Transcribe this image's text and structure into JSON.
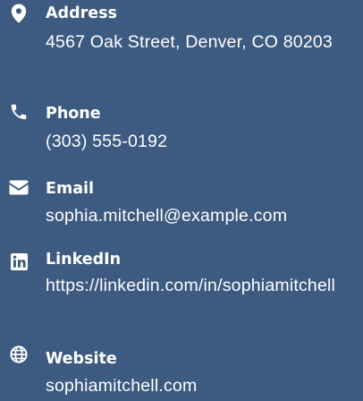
{
  "colors": {
    "background": "#3d5a80",
    "text": "#ffffff"
  },
  "contacts": [
    {
      "icon": "map-pin-icon",
      "label": "Address",
      "value": "4567 Oak Street, Denver, CO 80203"
    },
    {
      "icon": "phone-icon",
      "label": "Phone",
      "value": "(303) 555-0192"
    },
    {
      "icon": "envelope-icon",
      "label": "Email",
      "value": "sophia.mitchell@example.com"
    },
    {
      "icon": "linkedin-icon",
      "label": "LinkedIn",
      "value": "https://linkedin.com/in/sophiamitchell"
    },
    {
      "icon": "globe-icon",
      "label": "Website",
      "value": "sophiamitchell.com"
    }
  ]
}
